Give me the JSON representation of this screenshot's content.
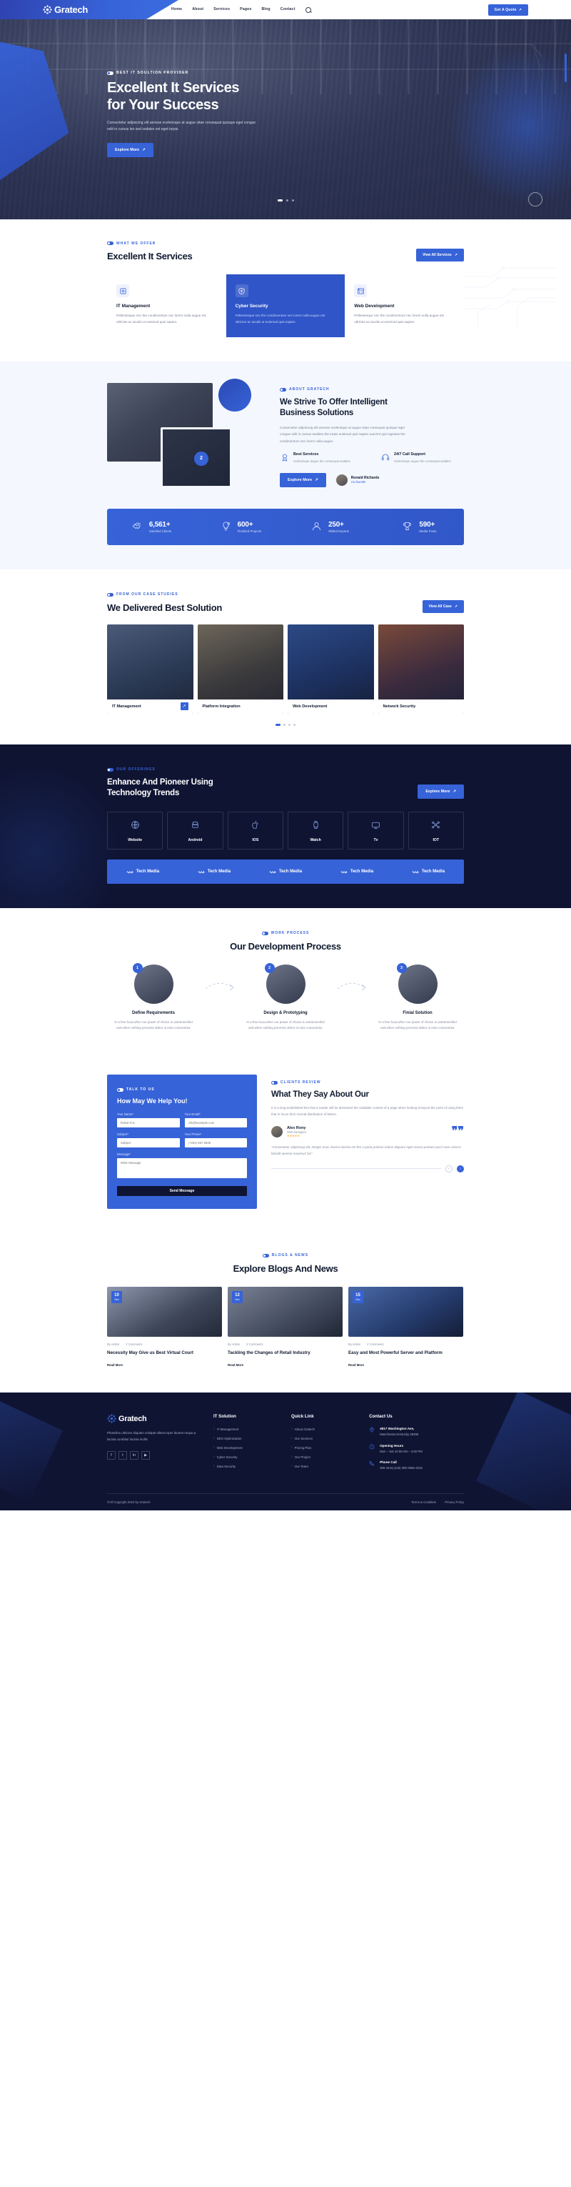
{
  "header": {
    "logo_text": "Gratech",
    "nav": [
      {
        "label": "Home"
      },
      {
        "label": "About"
      },
      {
        "label": "Services"
      },
      {
        "label": "Pages"
      },
      {
        "label": "Blog"
      },
      {
        "label": "Contact"
      }
    ],
    "search_icon": "search-icon",
    "quote_button": "Get A Quote"
  },
  "hero": {
    "eyebrow": "BEST IT SOULTION PROVIDER",
    "title_line1": "Excellent It Services",
    "title_line2": "for Your Success",
    "description": "Consectetur adipiscing elit aenean scelerisque at augue vitae consequat quisque eget congue velit in cursus leo sed sodales est eget turpis.",
    "button": "Explore More"
  },
  "services": {
    "eyebrow": "WHAT WE OFFER",
    "title": "Excellent It Services",
    "view_all": "View All Services",
    "cards": [
      {
        "icon": "server-management-icon",
        "title": "IT Management",
        "text": "Pellentesque nec the condimentum nec lorem nulla augue est ultricies ac iaculis ut euismod quis sapien."
      },
      {
        "icon": "shield-lock-icon",
        "title": "Cyber Security",
        "text": "Pellentesque nec the condimentum nec lorem nulla augue est ultricies ac iaculis ut euismod quis sapien."
      },
      {
        "icon": "web-browser-icon",
        "title": "Web Development",
        "text": "Pellentesque nec the condimentum nec lorem nulla augue est ultricies ac iaculis ut euismod quis sapien."
      }
    ]
  },
  "about": {
    "eyebrow": "ABOUT GRATECH",
    "title_line1": "We Strive To Offer Intelligent",
    "title_line2": "Business Solutions",
    "description": "Consectetur adipiscing elit aenean scelerisque at augue vitae consequat quisque eget congue velit in cursus sodales the turpis euismod quis sapien aucrsnt quis egestas the condimentum nec lorem nulla augue.",
    "badge_number": "2",
    "features": [
      {
        "icon": "medal-icon",
        "title": "Best Services",
        "text": "Scelerisque augue the consequat sodales"
      },
      {
        "icon": "headphone-icon",
        "title": "24/7 Call Support",
        "text": "Scelerisque augue the consequat sodales"
      }
    ],
    "button": "Explore More",
    "author_name": "Ronald Richards",
    "author_role": "Co-founder"
  },
  "counters": [
    {
      "icon": "handshake-icon",
      "value": "6,561+",
      "label": "Satisfied Clients"
    },
    {
      "icon": "idea-icon",
      "value": "600+",
      "label": "Finished Projects"
    },
    {
      "icon": "expert-icon",
      "value": "250+",
      "label": "Skilled Experts"
    },
    {
      "icon": "trophy-icon",
      "value": "590+",
      "label": "Media Posts"
    }
  ],
  "cases": {
    "eyebrow": "FROM OUR CASE STUDIES",
    "title": "We Delivered Best Solution",
    "view_all": "View All Case",
    "items": [
      {
        "title": "IT Management",
        "arrow": "↗"
      },
      {
        "title": "Platform Integration",
        "arrow": "↗"
      },
      {
        "title": "Web Development",
        "arrow": "↗"
      },
      {
        "title": "Network Security",
        "arrow": "↗"
      }
    ],
    "dots": 4,
    "active_dot": 1
  },
  "trends": {
    "eyebrow": "OUR OFFERINGS",
    "title_line1": "Enhance And Pioneer Using",
    "title_line2": "Technology Trends",
    "button": "Explore More",
    "techs": [
      {
        "icon": "globe-icon",
        "label": "Website"
      },
      {
        "icon": "android-icon",
        "label": "Android"
      },
      {
        "icon": "apple-icon",
        "label": "IOS"
      },
      {
        "icon": "watch-icon",
        "label": "Watch"
      },
      {
        "icon": "tv-icon",
        "label": "Tv"
      },
      {
        "icon": "iot-icon",
        "label": "IOT"
      }
    ],
    "media_items": [
      {
        "icon": "wave-icon",
        "label": "Tech Media"
      },
      {
        "icon": "wave-icon",
        "label": "Tech Media"
      },
      {
        "icon": "wave-icon",
        "label": "Tech Media"
      },
      {
        "icon": "wave-icon",
        "label": "Tech Media"
      },
      {
        "icon": "wave-icon",
        "label": "Tech Media"
      }
    ]
  },
  "process": {
    "eyebrow": "WORK PROCESS",
    "title": "Our Development Process",
    "steps": [
      {
        "num": "1",
        "title": "Define Requirements",
        "text": "In a free hour,when our power of choice is untrammelled and when nothing prevents debor ot ente consectetur"
      },
      {
        "num": "2",
        "title": "Design & Prototyping",
        "text": "In a free hour,when our power of choice is untrammelled and when nothing prevents debor ot ente consectetur"
      },
      {
        "num": "3",
        "title": "Finial Solution",
        "text": "In a free hour,when our power of choice is untrammelled and when nothing prevents debor ot ente consectetur"
      }
    ]
  },
  "contact": {
    "eyebrow": "TALK TO US",
    "title": "How May We Help You!",
    "fields": {
      "name_label": "Your Name*",
      "name_placeholder": "Robot Fox",
      "email_label": "Your Email*",
      "email_placeholder": "info@example.com",
      "subject_label": "Subject*",
      "subject_placeholder": "Subject",
      "phone_label": "Your Phone*",
      "phone_placeholder": "(+261) 657 5846",
      "message_label": "Message*",
      "message_placeholder": "Write Message"
    },
    "submit": "Send Message"
  },
  "testimonial": {
    "eyebrow": "CLIENTS REVIEW",
    "title": "What They Say About Our",
    "intro": "It is a long established fact that a reader will be distracted the readable content of a page when looking at layout the point of using them that in focus their normal distribution of letters.",
    "person_name": "Alex Rony",
    "person_role": "Web Designer",
    "rating": "★★★★★",
    "quote": "“Consectetur adipiscing elit, Integer nunc viverra laoreet est the a porta pretium metus aliquam eget massa pretium purci nunc viverra blandit aenean maximus fac”",
    "prev": "‹",
    "next": "›"
  },
  "blog": {
    "eyebrow": "BLOGS & NEWS",
    "title": "Explore Blogs And News",
    "posts": [
      {
        "day": "10",
        "month": "Dec",
        "author": "By Admin",
        "comments": "2 Comments",
        "title": "Necessity May Give us Best Virtual Court",
        "read_more": "Read More"
      },
      {
        "day": "12",
        "month": "Dec",
        "author": "By Admin",
        "comments": "2 Comments",
        "title": "Tackling the Changes of Retail Industry",
        "read_more": "Read More"
      },
      {
        "day": "15",
        "month": "Dec",
        "author": "By Admin",
        "comments": "2 Comments",
        "title": "Easy and Most Powerful Server and Platform",
        "read_more": "Read More"
      }
    ]
  },
  "footer": {
    "logo_text": "Gratech",
    "about": "Phasellus ultricies aliquam volutpat ullamcorper laoreet neque,a lacinia curabitur lacinia mollis",
    "socials": [
      {
        "icon": "facebook-icon",
        "glyph": "f"
      },
      {
        "icon": "twitter-icon",
        "glyph": "t"
      },
      {
        "icon": "linkedin-icon",
        "glyph": "in"
      },
      {
        "icon": "youtube-icon",
        "glyph": "▶"
      }
    ],
    "col1_title": "IT Solution",
    "col1_links": [
      "IT Management",
      "SEO Optimization",
      "Web Development",
      "Cyber Security",
      "Data Security"
    ],
    "col2_title": "Quick Link",
    "col2_links": [
      "About Gratech",
      "Our Services",
      "Pricing Plan",
      "Our Project",
      "Our Team"
    ],
    "contact_title": "Contact Us",
    "address_icon": "location-icon",
    "address_title": "4817 Washington Ave,",
    "address_text": "Manchester,Kentucky 39495",
    "hours_icon": "clock-icon",
    "hours_title": "Opening Hours",
    "hours_text": "Mon – Sat 10:00 AM – 4:00 PM",
    "phone_icon": "phone-icon",
    "phone_title": "Phone Call",
    "phone_text": "306-4444,(415) 308-3555-4515",
    "copyright": "©All Copyright 2024 by Gratech",
    "bottom_links": [
      "Terms & Condition",
      "Privacy Policy"
    ]
  },
  "colors": {
    "brand": "#3763d8",
    "dark": "#0f1433",
    "light": "#f4f7fd"
  }
}
